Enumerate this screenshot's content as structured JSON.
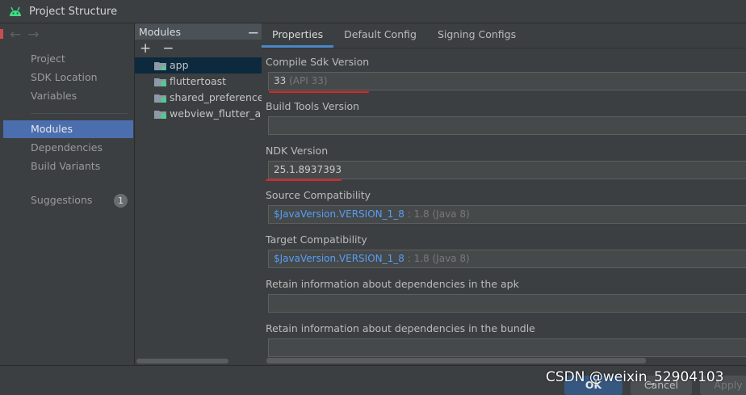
{
  "window": {
    "title": "Project Structure"
  },
  "nav": {
    "items": [
      "Project",
      "SDK Location",
      "Variables"
    ],
    "selected": "Modules",
    "items2": [
      "Dependencies",
      "Build Variants"
    ],
    "suggestions_label": "Suggestions",
    "suggestions_count": "1"
  },
  "modules": {
    "header": "Modules",
    "add": "+",
    "remove": "−",
    "minimize": "—",
    "list": [
      "app",
      "fluttertoast",
      "shared_preferences",
      "webview_flutter_and"
    ]
  },
  "tabs": [
    "Properties",
    "Default Config",
    "Signing Configs"
  ],
  "properties": {
    "compile_sdk_label": "Compile Sdk Version",
    "compile_sdk_value": "33",
    "compile_sdk_hint": "(API 33)",
    "build_tools_label": "Build Tools Version",
    "build_tools_value": "",
    "ndk_label": "NDK Version",
    "ndk_value": "25.1.8937393",
    "source_compat_label": "Source Compatibility",
    "source_compat_var": "$JavaVersion.VERSION_1_8",
    "source_compat_hint": ": 1.8 (Java 8)",
    "target_compat_label": "Target Compatibility",
    "target_compat_var": "$JavaVersion.VERSION_1_8",
    "target_compat_hint": ": 1.8 (Java 8)",
    "retain_apk_label": "Retain information about dependencies in the apk",
    "retain_bundle_label": "Retain information about dependencies in the bundle"
  },
  "buttons": {
    "ok": "OK",
    "cancel": "Cancel",
    "apply": "Apply"
  },
  "watermark": "CSDN @weixin_52904103",
  "colors": {
    "selection": "#4b6eaf",
    "link": "#589df6",
    "annotation": "#e02424",
    "android": "#3ddc84"
  }
}
